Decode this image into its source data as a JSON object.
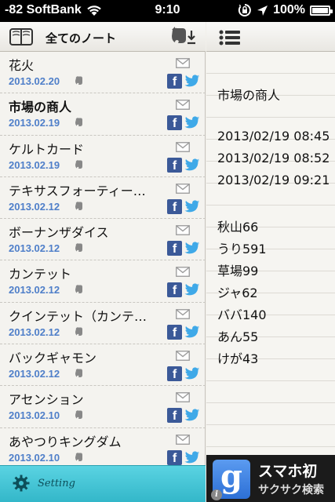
{
  "status_bar": {
    "carrier": "-82 SoftBank",
    "time": "9:10",
    "battery": "100%",
    "battery_level": 1.0
  },
  "left_header": {
    "title": "全てのノート"
  },
  "notes": [
    {
      "title": "花火",
      "date": "2013.02.20",
      "bold": false
    },
    {
      "title": "市場の商人",
      "date": "2013.02.19",
      "bold": true
    },
    {
      "title": "ケルトカード",
      "date": "2013.02.19",
      "bold": false
    },
    {
      "title": "テキサスフォーティー…",
      "date": "2013.02.12",
      "bold": false
    },
    {
      "title": "ボーナンザダイス",
      "date": "2013.02.12",
      "bold": false
    },
    {
      "title": "カンテット",
      "date": "2013.02.12",
      "bold": false
    },
    {
      "title": "クインテット（カンテ…",
      "date": "2013.02.12",
      "bold": false
    },
    {
      "title": "バックギャモン",
      "date": "2013.02.12",
      "bold": false
    },
    {
      "title": "アセンション",
      "date": "2013.02.10",
      "bold": false
    },
    {
      "title": "あやつりキングダム",
      "date": "2013.02.10",
      "bold": false
    }
  ],
  "settings": {
    "label": "Setting"
  },
  "detail": {
    "title": "市場の商人",
    "timestamps": [
      "2013/02/19 08:45",
      "2013/02/19 08:52",
      "2013/02/19 09:21"
    ],
    "entries": [
      "秋山66",
      "うり591",
      "草場99",
      "ジャ62",
      "ババ140",
      "あん55",
      "けが43"
    ]
  },
  "ad": {
    "line1": "スマホ初",
    "line2": "サクサク検索"
  },
  "colors": {
    "date_blue": "#4f7fc9",
    "facebook": "#3b5998",
    "twitter": "#3fa9e8",
    "settings_teal": "#3fc2d3"
  }
}
